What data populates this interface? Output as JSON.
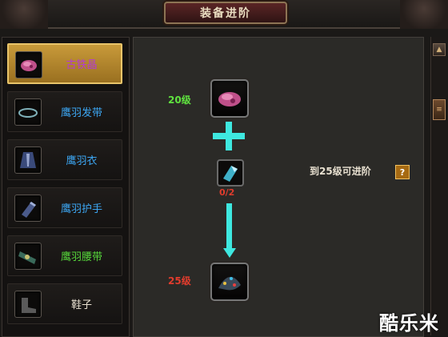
{
  "window": {
    "title": "装备进阶"
  },
  "items": [
    {
      "label": "古铁晶",
      "color": "#b23ad6",
      "icon": "purple-crystal-icon",
      "selected": true
    },
    {
      "label": "鹰羽发带",
      "color": "#3ca6f2",
      "icon": "headband-icon",
      "selected": false
    },
    {
      "label": "鹰羽衣",
      "color": "#3ca6f2",
      "icon": "robe-icon",
      "selected": false
    },
    {
      "label": "鹰羽护手",
      "color": "#3ca6f2",
      "icon": "gauntlet-icon",
      "selected": false
    },
    {
      "label": "鹰羽腰带",
      "color": "#56d63a",
      "icon": "belt-icon",
      "selected": false
    },
    {
      "label": "鞋子",
      "color": "#e8e0d0",
      "icon": "shoes-icon",
      "selected": false
    }
  ],
  "upgrade": {
    "current_level": "20级",
    "material_count": "0/2",
    "target_level": "25级",
    "requirement": "到25级可进阶",
    "help": "?"
  },
  "watermark": "酷乐米",
  "colors": {
    "plus": "#3ee8e0",
    "arrow": "#3ee8e0",
    "level_ok": "#5fe23f",
    "level_target": "#e23c2d"
  }
}
